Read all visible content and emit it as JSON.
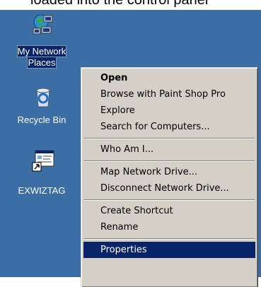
{
  "caption": "loaded into the control panel",
  "desktop_icons": [
    {
      "name": "My Network Places",
      "line1": "My Network",
      "line2": "Places",
      "selected": true
    },
    {
      "name": "Recycle Bin",
      "line1": "Recycle Bin",
      "line2": ""
    },
    {
      "name": "EXWIZTAG",
      "line1": "EXWIZTAG",
      "line2": ""
    }
  ],
  "context_menu": {
    "items": [
      {
        "label": "Open",
        "bold": true
      },
      {
        "label": "Browse with Paint Shop Pro"
      },
      {
        "label": "Explore"
      },
      {
        "label": "Search for Computers..."
      },
      {
        "label": "Who Am I..."
      },
      {
        "label": "Map Network Drive..."
      },
      {
        "label": "Disconnect Network Drive..."
      },
      {
        "label": "Create Shortcut"
      },
      {
        "label": "Rename"
      },
      {
        "label": "Properties",
        "highlighted": true
      }
    ]
  },
  "colors": {
    "desktop": "#3a6ea5",
    "selection": "#0a246a",
    "menu_face": "#d4d0c8"
  }
}
